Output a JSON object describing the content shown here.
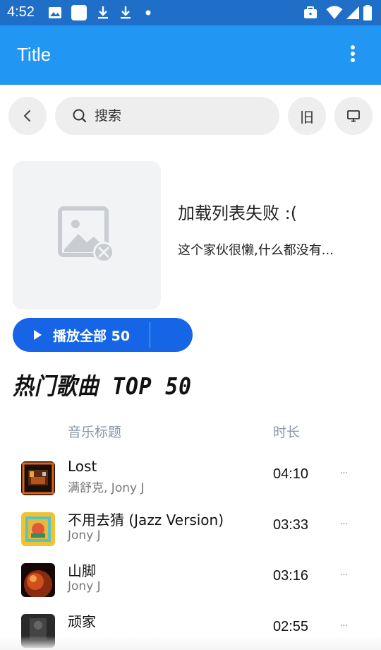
{
  "status_bar": {
    "time": "4:52",
    "left_icons": [
      "image-icon",
      "app-square-icon",
      "download-icon",
      "download-icon",
      "dot-icon"
    ],
    "right_icons": [
      "briefcase-icon",
      "wifi-icon",
      "signal-icon",
      "battery-icon"
    ]
  },
  "app_bar": {
    "title": "Title",
    "menu_icon": "more-vertical-icon"
  },
  "search": {
    "placeholder": "搜索",
    "old_label": "旧"
  },
  "playlist": {
    "title": "加载列表失败 :(",
    "description": "这个家伙很懒,什么都没有...",
    "play_all_label": "播放全部 50"
  },
  "section_title": "热门歌曲 TOP 50",
  "columns": {
    "title": "音乐标题",
    "duration": "时长"
  },
  "songs": [
    {
      "title": "Lost",
      "artist": "满舒克, Jony J",
      "duration": "04:10",
      "more": "···"
    },
    {
      "title": "不用去猜 (Jazz Version)",
      "artist": "Jony J",
      "duration": "03:33",
      "more": "···"
    },
    {
      "title": "山脚",
      "artist": "Jony J",
      "duration": "03:16",
      "more": "···"
    },
    {
      "title": "顽家",
      "artist": "",
      "duration": "02:55",
      "more": "···"
    }
  ],
  "colors": {
    "status_bar": "#1F6FC8",
    "app_bar": "#2196F3",
    "play_button": "#1565E6",
    "column_header": "#8a96a6"
  }
}
